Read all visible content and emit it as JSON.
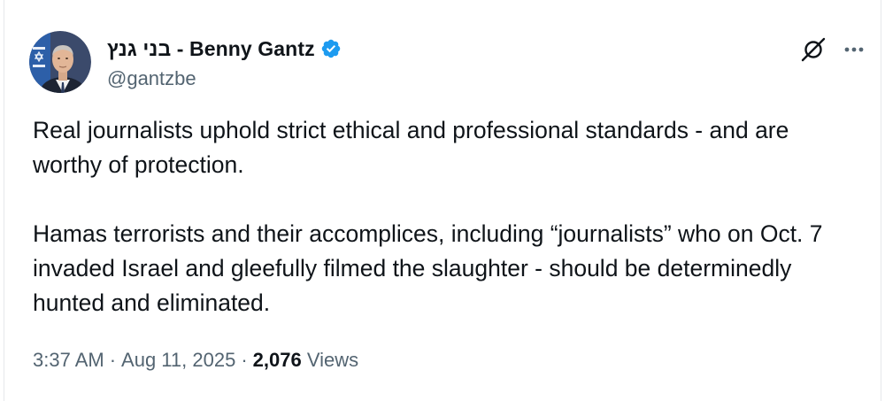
{
  "author": {
    "display_name": "בני גנץ - Benny Gantz",
    "handle": "@gantzbe",
    "verified": true,
    "avatar_icon": "profile-photo"
  },
  "tweet": {
    "paragraphs": [
      "Real journalists uphold strict ethical and professional standards - and are worthy of protection.",
      "Hamas terrorists and their accomplices, including “journalists” who on Oct. 7 invaded Israel and gleefully filmed the slaughter - should be determinedly hunted and eliminated."
    ]
  },
  "meta": {
    "time": "3:37 AM",
    "separator": "·",
    "date": "Aug 11, 2025",
    "views_count": "2,076",
    "views_label": "Views"
  },
  "icons": {
    "verified": "verified-badge-icon",
    "grok": "grok-icon",
    "more": "more-options-icon"
  },
  "colors": {
    "text_primary": "#0f1419",
    "text_secondary": "#536471",
    "verified_blue": "#1d9bf0"
  }
}
